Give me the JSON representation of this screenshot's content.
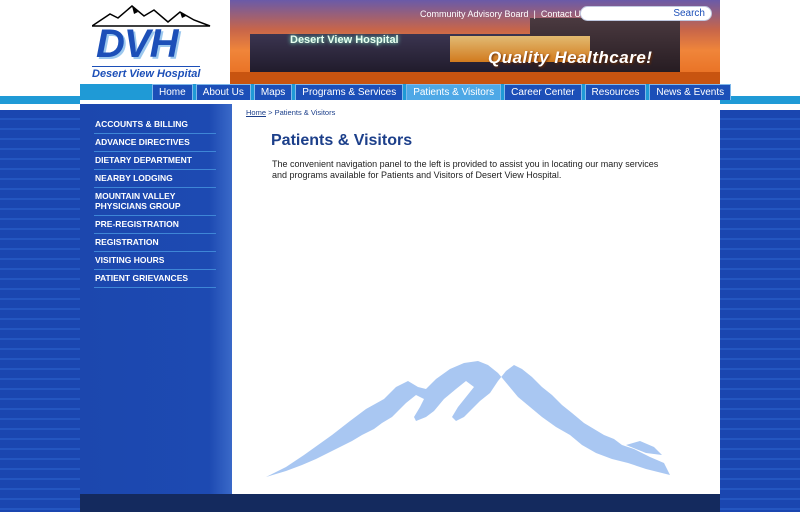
{
  "header": {
    "logo": {
      "title": "DVH",
      "subtitle": "Desert View Hospital"
    },
    "banner": {
      "hospital_sign": "Desert View Hospital",
      "tagline": "Quality Healthcare!"
    },
    "top_links": [
      "Community Advisory Board",
      "Contact Us"
    ],
    "search": {
      "button_label": "Search",
      "placeholder": ""
    }
  },
  "nav": {
    "items": [
      {
        "label": "Home"
      },
      {
        "label": "About Us"
      },
      {
        "label": "Maps"
      },
      {
        "label": "Programs & Services"
      },
      {
        "label": "Patients & Visitors",
        "active": true
      },
      {
        "label": "Career Center"
      },
      {
        "label": "Resources"
      },
      {
        "label": "News & Events"
      }
    ]
  },
  "sidebar": {
    "items": [
      {
        "label": "ACCOUNTS & BILLING"
      },
      {
        "label": "ADVANCE DIRECTIVES"
      },
      {
        "label": "DIETARY DEPARTMENT"
      },
      {
        "label": "NEARBY LODGING"
      },
      {
        "label": "MOUNTAIN VALLEY PHYSICIANS GROUP"
      },
      {
        "label": "PRE-REGISTRATION"
      },
      {
        "label": "REGISTRATION"
      },
      {
        "label": "VISITING HOURS"
      },
      {
        "label": "PATIENT GRIEVANCES"
      }
    ]
  },
  "breadcrumb": {
    "home": "Home",
    "separator": ">",
    "current": "Patients & Visitors"
  },
  "main": {
    "title": "Patients & Visitors",
    "body": "The convenient navigation panel to the left is provided to assist you in locating our many services and programs available for Patients and Visitors of Desert View Hospital."
  },
  "colors": {
    "brand_blue": "#1c4fb8",
    "nav_accent": "#1f9ad6",
    "title_blue": "#1c3f8a",
    "mountain_light": "#a9c7f2"
  },
  "icons": {
    "decorative_mountain": "mountain-graphic"
  }
}
